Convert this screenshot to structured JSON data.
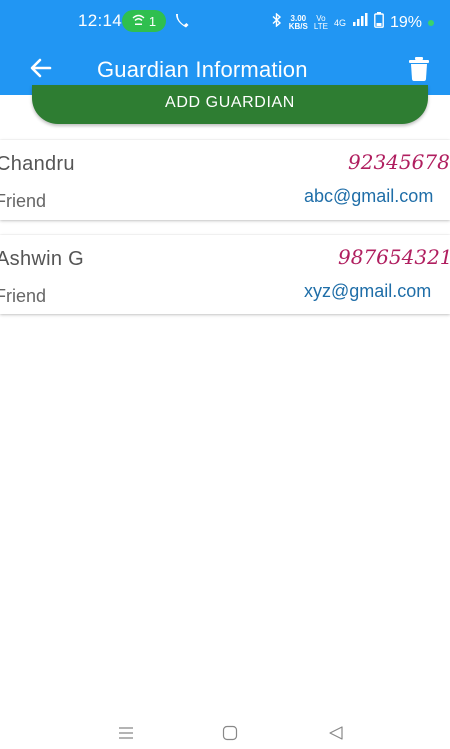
{
  "status_bar": {
    "time": "12:14",
    "hotspot_count": "1",
    "data_speed": "3.00\nKB/S",
    "volte": "Vo\nLTE",
    "network": "4G",
    "battery": "19%",
    "icons": [
      "wifi-hotspot-icon",
      "phone-icon",
      "bluetooth-icon",
      "signal-icon",
      "battery-icon"
    ]
  },
  "app_bar": {
    "title": "Guardian Information",
    "icons": [
      "back-arrow-icon",
      "trash-icon"
    ]
  },
  "add_button": {
    "label": "ADD GUARDIAN"
  },
  "guardians": [
    {
      "name": "Chandru",
      "relation": "Friend",
      "phone": "92345678",
      "email": "abc@gmail.com"
    },
    {
      "name": "Ashwin G",
      "relation": "Friend",
      "phone": "987654321",
      "email": "xyz@gmail.com"
    }
  ],
  "nav_bar": {
    "icons": [
      "menu-icon",
      "home-icon",
      "back-icon"
    ]
  },
  "colors": {
    "primary": "#2196f3",
    "button": "#2e7d32",
    "phone_text": "#b01e5f",
    "email_text": "#1f6ea8",
    "hotspot_pill": "#2fbf4f"
  }
}
